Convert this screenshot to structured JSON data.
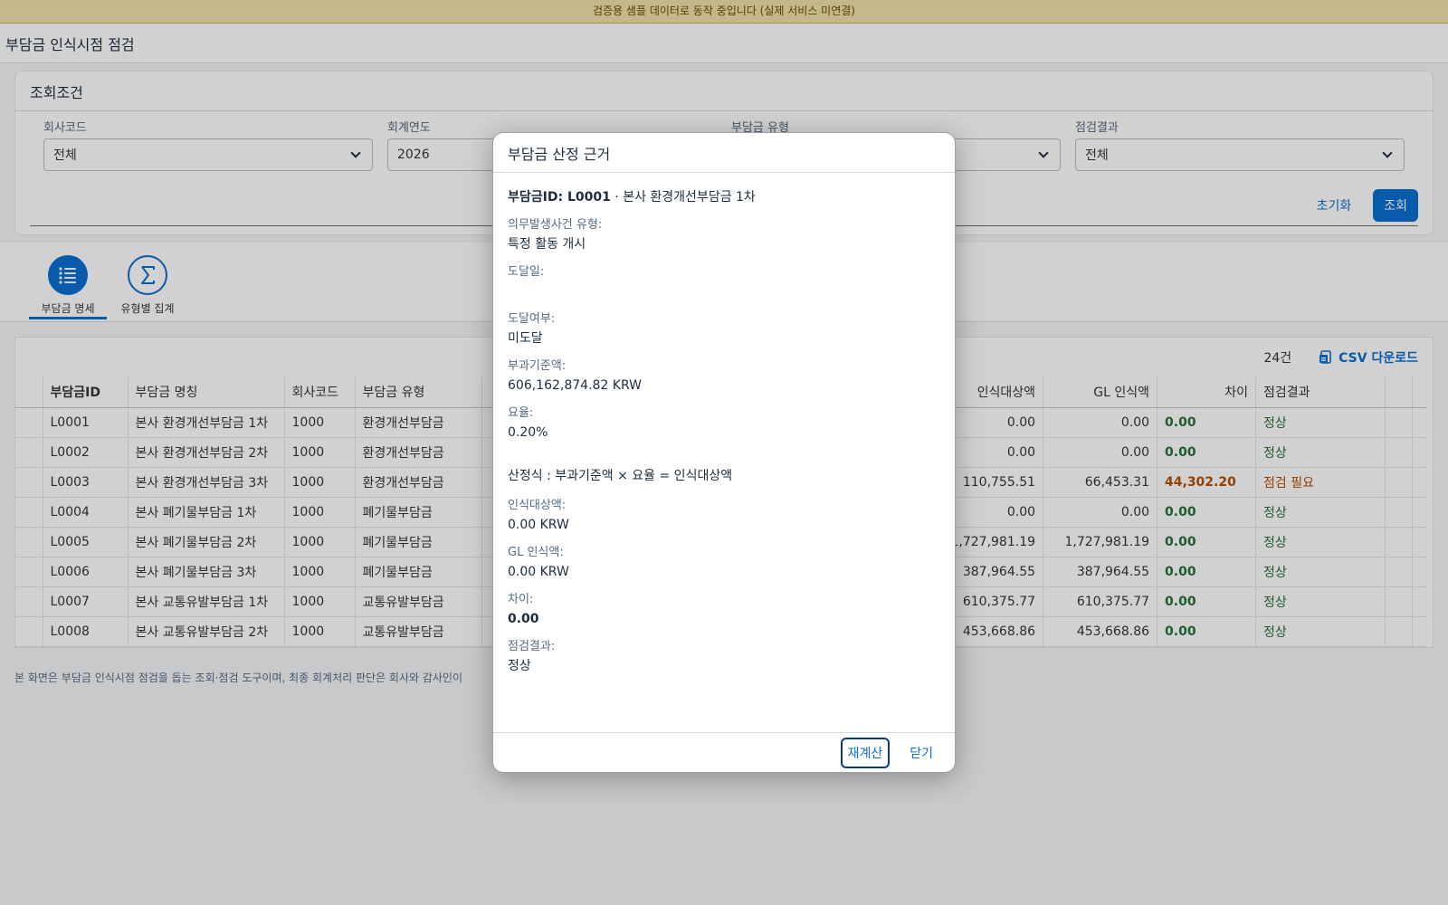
{
  "banner": "검증용 샘플 데이터로 동작 중입니다 (실제 서비스 미연결)",
  "app": {
    "title": "부담금 인식시점 점검"
  },
  "filter": {
    "header": "조회조건",
    "fields": [
      {
        "label": "회사코드",
        "value": "전체"
      },
      {
        "label": "회계연도",
        "value": "2026"
      },
      {
        "label": "부담금 유형",
        "value": ""
      },
      {
        "label": "점검결과",
        "value": "전체"
      }
    ],
    "reset_label": "초기화",
    "search_label": "조회"
  },
  "tabs": [
    {
      "label": "부담금 명세",
      "icon": "list-icon"
    },
    {
      "label": "유형별 집계",
      "icon": "sigma-icon"
    }
  ],
  "table": {
    "count": "24건",
    "csv_label": "CSV 다운로드",
    "headers": [
      "부담금ID",
      "부담금 명칭",
      "회사코드",
      "부담금 유형",
      "인식대상액",
      "GL 인식액",
      "차이",
      "점검결과"
    ],
    "rows": [
      {
        "id": "L0001",
        "name": "본사 환경개선부담금 1차",
        "company": "1000",
        "type": "환경개선부담금",
        "target": "0.00",
        "gl": "0.00",
        "diff": "0.00",
        "result": "정상"
      },
      {
        "id": "L0002",
        "name": "본사 환경개선부담금 2차",
        "company": "1000",
        "type": "환경개선부담금",
        "target": "0.00",
        "gl": "0.00",
        "diff": "0.00",
        "result": "정상"
      },
      {
        "id": "L0003",
        "name": "본사 환경개선부담금 3차",
        "company": "1000",
        "type": "환경개선부담금",
        "target": "110,755.51",
        "gl": "66,453.31",
        "diff": "44,302.20",
        "result": "점검 필요"
      },
      {
        "id": "L0004",
        "name": "본사 폐기물부담금 1차",
        "company": "1000",
        "type": "폐기물부담금",
        "target": "0.00",
        "gl": "0.00",
        "diff": "0.00",
        "result": "정상"
      },
      {
        "id": "L0005",
        "name": "본사 폐기물부담금 2차",
        "company": "1000",
        "type": "폐기물부담금",
        "target": "1,727,981.19",
        "gl": "1,727,981.19",
        "diff": "0.00",
        "result": "정상"
      },
      {
        "id": "L0006",
        "name": "본사 폐기물부담금 3차",
        "company": "1000",
        "type": "폐기물부담금",
        "target": "387,964.55",
        "gl": "387,964.55",
        "diff": "0.00",
        "result": "정상"
      },
      {
        "id": "L0007",
        "name": "본사 교통유발부담금 1차",
        "company": "1000",
        "type": "교통유발부담금",
        "target": "610,375.77",
        "gl": "610,375.77",
        "diff": "0.00",
        "result": "정상"
      },
      {
        "id": "L0008",
        "name": "본사 교통유발부담금 2차",
        "company": "1000",
        "type": "교통유발부담금",
        "target": "453,668.86",
        "gl": "453,668.86",
        "diff": "0.00",
        "result": "정상"
      }
    ]
  },
  "footnote": "본 화면은 부담금 인식시점 점검을 돕는 조회·점검 도구이며, 최종 회계처리 판단은 회사와 감사인이",
  "dialog": {
    "title": "부담금 산정 근거",
    "id_label": "부담금ID: L0001",
    "id_sep": " · ",
    "id_name": "본사 환경개선부담금 1차",
    "fields": [
      {
        "key": "의무발생사건 유형:",
        "value": "특정 활동 개시"
      },
      {
        "key": "도달일:",
        "value": ""
      },
      {
        "key": "도달여부:",
        "value": "미도달"
      },
      {
        "key": "부과기준액:",
        "value": "606,162,874.82 KRW"
      },
      {
        "key": "요율:",
        "value": "0.20%"
      }
    ],
    "formula_label": "산정식 :",
    "formula": "부과기준액 × 요율 = 인식대상액",
    "results": [
      {
        "key": "인식대상액:",
        "value": "0.00 KRW"
      },
      {
        "key": "GL 인식액:",
        "value": "0.00 KRW"
      },
      {
        "key": "차이:",
        "value": "0.00"
      },
      {
        "key": "점검결과:",
        "value": "정상"
      }
    ],
    "recalc_label": "재계산",
    "close_label": "닫기"
  }
}
